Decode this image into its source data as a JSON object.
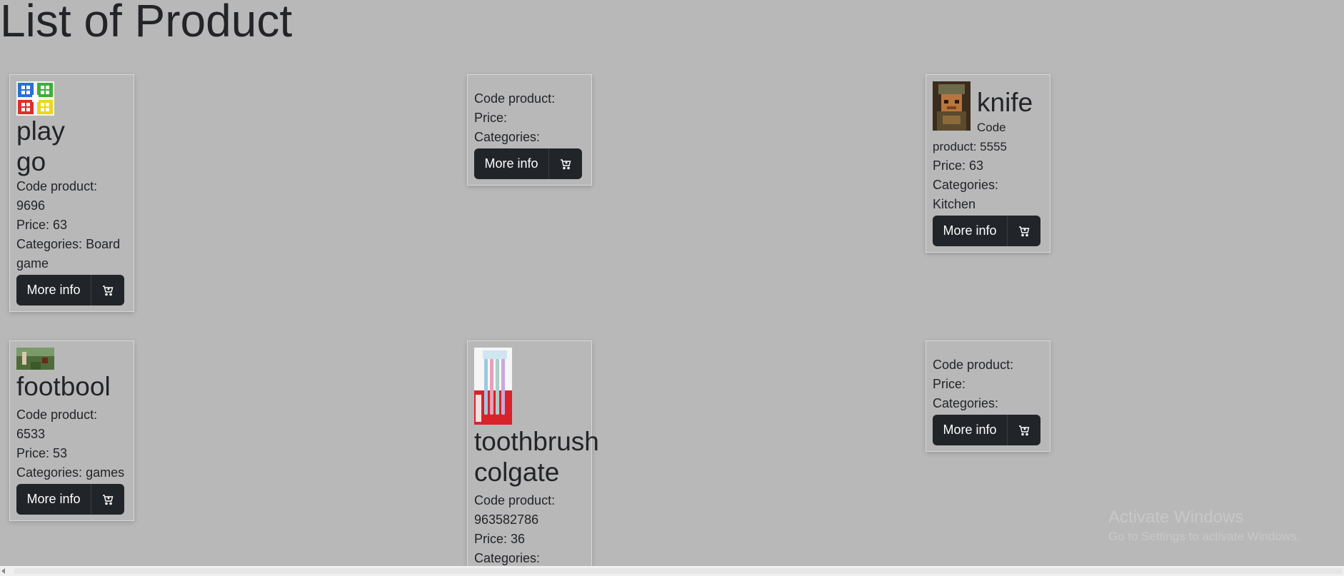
{
  "page": {
    "title": "List of Product"
  },
  "labels": {
    "code": "Code product:",
    "price": "Price:",
    "categories": "Categories:",
    "more_info": "More info"
  },
  "icons": {
    "cart": "cart-add-icon"
  },
  "products": [
    {
      "name": "play go",
      "code": "9696",
      "price": "63",
      "categories": "Board game",
      "image": "ludo-board-thumbnail"
    },
    {
      "name": "",
      "code": "",
      "price": "",
      "categories": "",
      "image": ""
    },
    {
      "name": "knife",
      "code": "5555",
      "price": "63",
      "categories": "Kitchen",
      "image": "pixel-character-thumbnail"
    },
    {
      "name": "footbool",
      "code": "6533",
      "price": "53",
      "categories": "games",
      "image": "football-scene-thumbnail"
    },
    {
      "name": "toothbrush colgate",
      "code": "963582786",
      "price": "36",
      "categories": "",
      "image": "toothbrush-pack-thumbnail"
    },
    {
      "name": "",
      "code": "",
      "price": "",
      "categories": "",
      "image": ""
    }
  ],
  "watermark": {
    "title": "Activate Windows",
    "subtitle": "Go to Settings to activate Windows."
  },
  "colors": {
    "page_bg": "#b8b8b8",
    "button_bg": "#212429",
    "button_text": "#ffffff"
  }
}
